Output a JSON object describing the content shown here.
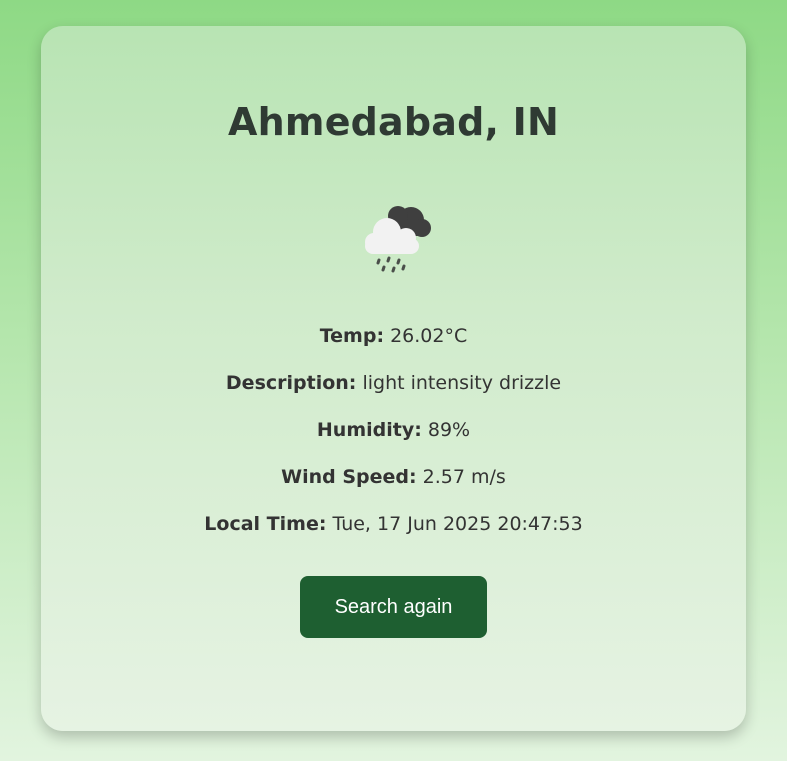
{
  "location": "Ahmedabad, IN",
  "weather_icon": "light-rain-cloud-icon",
  "details": {
    "temp": {
      "label": "Temp:",
      "value": "26.02°C"
    },
    "description": {
      "label": "Description:",
      "value": "light intensity drizzle"
    },
    "humidity": {
      "label": "Humidity:",
      "value": "89%"
    },
    "wind": {
      "label": "Wind Speed:",
      "value": "2.57 m/s"
    },
    "local_time": {
      "label": "Local Time:",
      "value": "Tue, 17 Jun 2025 20:47:53"
    }
  },
  "search_again_label": "Search again",
  "colors": {
    "button": "#1e5f31",
    "background_top": "#8ed985",
    "background_bottom": "#e2f4df"
  }
}
